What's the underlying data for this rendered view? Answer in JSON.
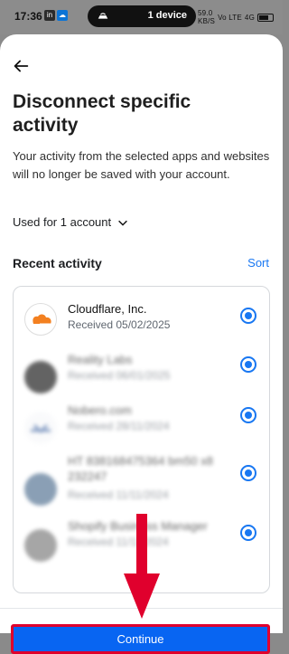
{
  "status": {
    "time": "17:36",
    "pill_label": "1 device",
    "speed": "59.0",
    "speed_unit": "KB/S",
    "network": "Vo LTE",
    "battery": "4G"
  },
  "page": {
    "title": "Disconnect specific activity",
    "description": "Your activity from the selected apps and websites will no longer be saved with your account.",
    "used_for": "Used for 1 account",
    "section_title": "Recent activity",
    "sort_label": "Sort",
    "continue_label": "Continue"
  },
  "activities": [
    {
      "name": "Cloudflare, Inc.",
      "date": "Received 05/02/2025"
    },
    {
      "name": "Reality Labs",
      "date": "Received 06/01/2025"
    },
    {
      "name": "Nobero.com",
      "date": "Received 28/11/2024"
    },
    {
      "name": "HT 838168475364 bm50 x8",
      "line2": "232247",
      "date": "Received 11/11/2024"
    },
    {
      "name": "Shopify Business Manager",
      "date": "Received 11/11/2024"
    }
  ],
  "icons": {
    "back": "back-arrow-icon",
    "dropdown": "chevron-down-icon",
    "radio": "radio-selected-icon",
    "annotation": "red-arrow-icon"
  },
  "colors": {
    "primary": "#1877f2",
    "button": "#0865f2",
    "annotation": "#e0002d"
  }
}
